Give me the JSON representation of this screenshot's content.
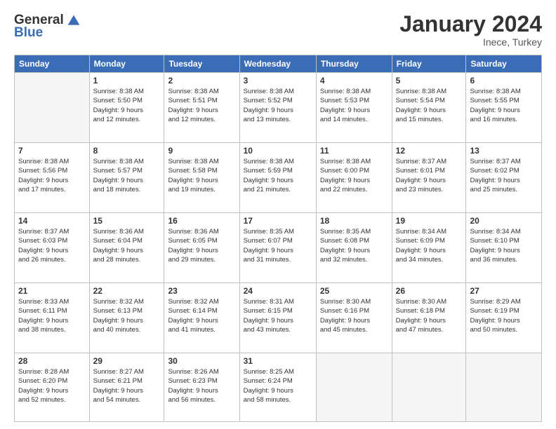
{
  "header": {
    "logo_general": "General",
    "logo_blue": "Blue",
    "month_title": "January 2024",
    "subtitle": "Inece, Turkey"
  },
  "days_of_week": [
    "Sunday",
    "Monday",
    "Tuesday",
    "Wednesday",
    "Thursday",
    "Friday",
    "Saturday"
  ],
  "weeks": [
    [
      {
        "day": "",
        "sunrise": "",
        "sunset": "",
        "daylight": "",
        "empty": true
      },
      {
        "day": "1",
        "sunrise": "Sunrise: 8:38 AM",
        "sunset": "Sunset: 5:50 PM",
        "daylight": "Daylight: 9 hours and 12 minutes."
      },
      {
        "day": "2",
        "sunrise": "Sunrise: 8:38 AM",
        "sunset": "Sunset: 5:51 PM",
        "daylight": "Daylight: 9 hours and 12 minutes."
      },
      {
        "day": "3",
        "sunrise": "Sunrise: 8:38 AM",
        "sunset": "Sunset: 5:52 PM",
        "daylight": "Daylight: 9 hours and 13 minutes."
      },
      {
        "day": "4",
        "sunrise": "Sunrise: 8:38 AM",
        "sunset": "Sunset: 5:53 PM",
        "daylight": "Daylight: 9 hours and 14 minutes."
      },
      {
        "day": "5",
        "sunrise": "Sunrise: 8:38 AM",
        "sunset": "Sunset: 5:54 PM",
        "daylight": "Daylight: 9 hours and 15 minutes."
      },
      {
        "day": "6",
        "sunrise": "Sunrise: 8:38 AM",
        "sunset": "Sunset: 5:55 PM",
        "daylight": "Daylight: 9 hours and 16 minutes."
      }
    ],
    [
      {
        "day": "7",
        "sunrise": "Sunrise: 8:38 AM",
        "sunset": "Sunset: 5:56 PM",
        "daylight": "Daylight: 9 hours and 17 minutes."
      },
      {
        "day": "8",
        "sunrise": "Sunrise: 8:38 AM",
        "sunset": "Sunset: 5:57 PM",
        "daylight": "Daylight: 9 hours and 18 minutes."
      },
      {
        "day": "9",
        "sunrise": "Sunrise: 8:38 AM",
        "sunset": "Sunset: 5:58 PM",
        "daylight": "Daylight: 9 hours and 19 minutes."
      },
      {
        "day": "10",
        "sunrise": "Sunrise: 8:38 AM",
        "sunset": "Sunset: 5:59 PM",
        "daylight": "Daylight: 9 hours and 21 minutes."
      },
      {
        "day": "11",
        "sunrise": "Sunrise: 8:38 AM",
        "sunset": "Sunset: 6:00 PM",
        "daylight": "Daylight: 9 hours and 22 minutes."
      },
      {
        "day": "12",
        "sunrise": "Sunrise: 8:37 AM",
        "sunset": "Sunset: 6:01 PM",
        "daylight": "Daylight: 9 hours and 23 minutes."
      },
      {
        "day": "13",
        "sunrise": "Sunrise: 8:37 AM",
        "sunset": "Sunset: 6:02 PM",
        "daylight": "Daylight: 9 hours and 25 minutes."
      }
    ],
    [
      {
        "day": "14",
        "sunrise": "Sunrise: 8:37 AM",
        "sunset": "Sunset: 6:03 PM",
        "daylight": "Daylight: 9 hours and 26 minutes."
      },
      {
        "day": "15",
        "sunrise": "Sunrise: 8:36 AM",
        "sunset": "Sunset: 6:04 PM",
        "daylight": "Daylight: 9 hours and 28 minutes."
      },
      {
        "day": "16",
        "sunrise": "Sunrise: 8:36 AM",
        "sunset": "Sunset: 6:05 PM",
        "daylight": "Daylight: 9 hours and 29 minutes."
      },
      {
        "day": "17",
        "sunrise": "Sunrise: 8:35 AM",
        "sunset": "Sunset: 6:07 PM",
        "daylight": "Daylight: 9 hours and 31 minutes."
      },
      {
        "day": "18",
        "sunrise": "Sunrise: 8:35 AM",
        "sunset": "Sunset: 6:08 PM",
        "daylight": "Daylight: 9 hours and 32 minutes."
      },
      {
        "day": "19",
        "sunrise": "Sunrise: 8:34 AM",
        "sunset": "Sunset: 6:09 PM",
        "daylight": "Daylight: 9 hours and 34 minutes."
      },
      {
        "day": "20",
        "sunrise": "Sunrise: 8:34 AM",
        "sunset": "Sunset: 6:10 PM",
        "daylight": "Daylight: 9 hours and 36 minutes."
      }
    ],
    [
      {
        "day": "21",
        "sunrise": "Sunrise: 8:33 AM",
        "sunset": "Sunset: 6:11 PM",
        "daylight": "Daylight: 9 hours and 38 minutes."
      },
      {
        "day": "22",
        "sunrise": "Sunrise: 8:32 AM",
        "sunset": "Sunset: 6:13 PM",
        "daylight": "Daylight: 9 hours and 40 minutes."
      },
      {
        "day": "23",
        "sunrise": "Sunrise: 8:32 AM",
        "sunset": "Sunset: 6:14 PM",
        "daylight": "Daylight: 9 hours and 41 minutes."
      },
      {
        "day": "24",
        "sunrise": "Sunrise: 8:31 AM",
        "sunset": "Sunset: 6:15 PM",
        "daylight": "Daylight: 9 hours and 43 minutes."
      },
      {
        "day": "25",
        "sunrise": "Sunrise: 8:30 AM",
        "sunset": "Sunset: 6:16 PM",
        "daylight": "Daylight: 9 hours and 45 minutes."
      },
      {
        "day": "26",
        "sunrise": "Sunrise: 8:30 AM",
        "sunset": "Sunset: 6:18 PM",
        "daylight": "Daylight: 9 hours and 47 minutes."
      },
      {
        "day": "27",
        "sunrise": "Sunrise: 8:29 AM",
        "sunset": "Sunset: 6:19 PM",
        "daylight": "Daylight: 9 hours and 50 minutes."
      }
    ],
    [
      {
        "day": "28",
        "sunrise": "Sunrise: 8:28 AM",
        "sunset": "Sunset: 6:20 PM",
        "daylight": "Daylight: 9 hours and 52 minutes."
      },
      {
        "day": "29",
        "sunrise": "Sunrise: 8:27 AM",
        "sunset": "Sunset: 6:21 PM",
        "daylight": "Daylight: 9 hours and 54 minutes."
      },
      {
        "day": "30",
        "sunrise": "Sunrise: 8:26 AM",
        "sunset": "Sunset: 6:23 PM",
        "daylight": "Daylight: 9 hours and 56 minutes."
      },
      {
        "day": "31",
        "sunrise": "Sunrise: 8:25 AM",
        "sunset": "Sunset: 6:24 PM",
        "daylight": "Daylight: 9 hours and 58 minutes."
      },
      {
        "day": "",
        "sunrise": "",
        "sunset": "",
        "daylight": "",
        "empty": true
      },
      {
        "day": "",
        "sunrise": "",
        "sunset": "",
        "daylight": "",
        "empty": true
      },
      {
        "day": "",
        "sunrise": "",
        "sunset": "",
        "daylight": "",
        "empty": true
      }
    ]
  ]
}
